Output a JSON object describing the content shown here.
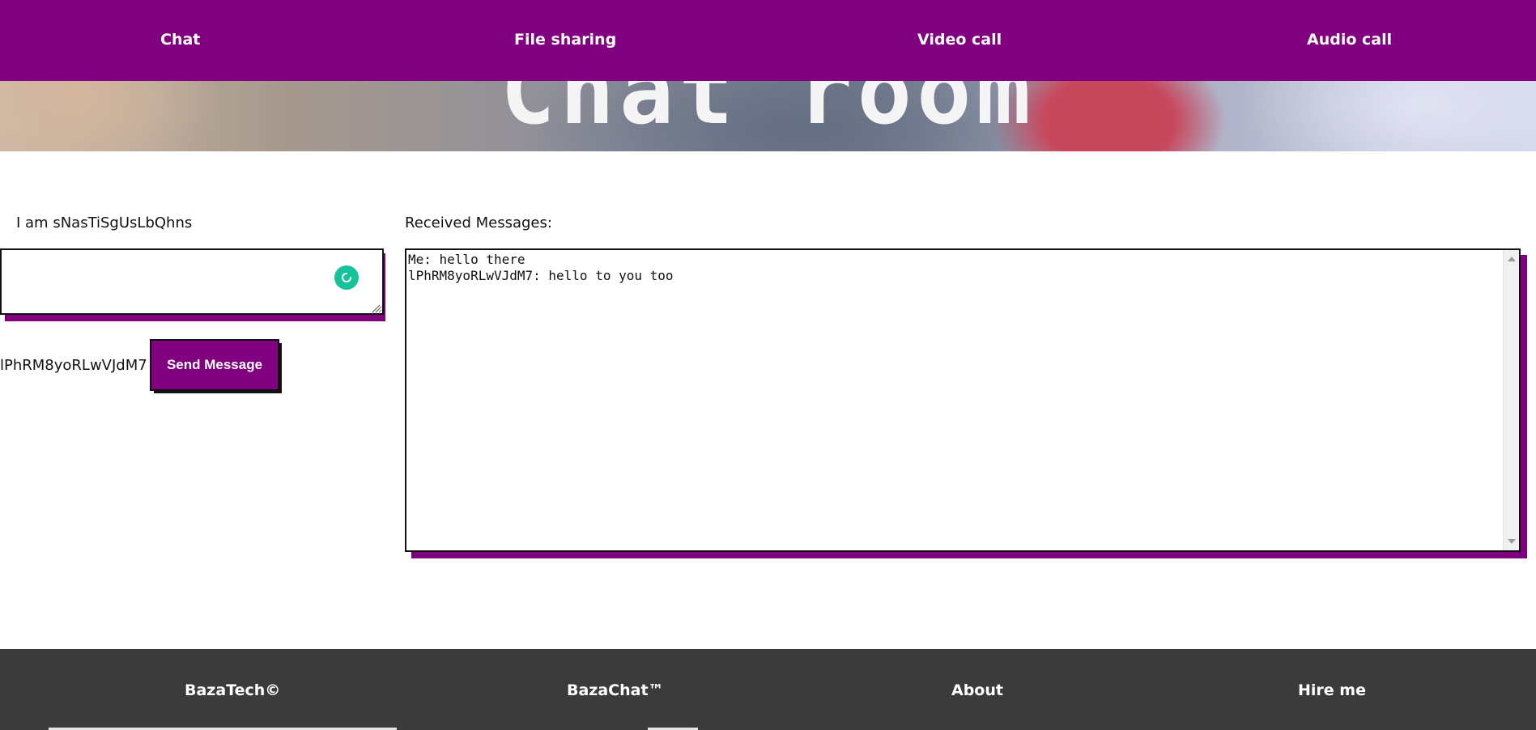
{
  "hero": {
    "title": "Chat room"
  },
  "nav": {
    "items": [
      {
        "label": "Chat"
      },
      {
        "label": "File sharing"
      },
      {
        "label": "Video call"
      },
      {
        "label": "Audio call"
      }
    ]
  },
  "compose": {
    "identity": "I am sNasTiSgUsLbQhns",
    "message_value": "",
    "recipient": "lPhRM8yoRLwVJdM7",
    "send_label": "Send Message"
  },
  "received": {
    "label": "Received Messages:",
    "messages": "Me: hello there\nlPhRM8yoRLwVJdM7: hello to you too"
  },
  "footer": {
    "items": [
      {
        "label": "BazaTech©"
      },
      {
        "label": "BazaChat™"
      },
      {
        "label": "About"
      },
      {
        "label": "Hire me"
      }
    ]
  },
  "colors": {
    "accent": "#800080",
    "footer_bg": "#3b3b3b",
    "grammar_icon": "#15c39a"
  }
}
